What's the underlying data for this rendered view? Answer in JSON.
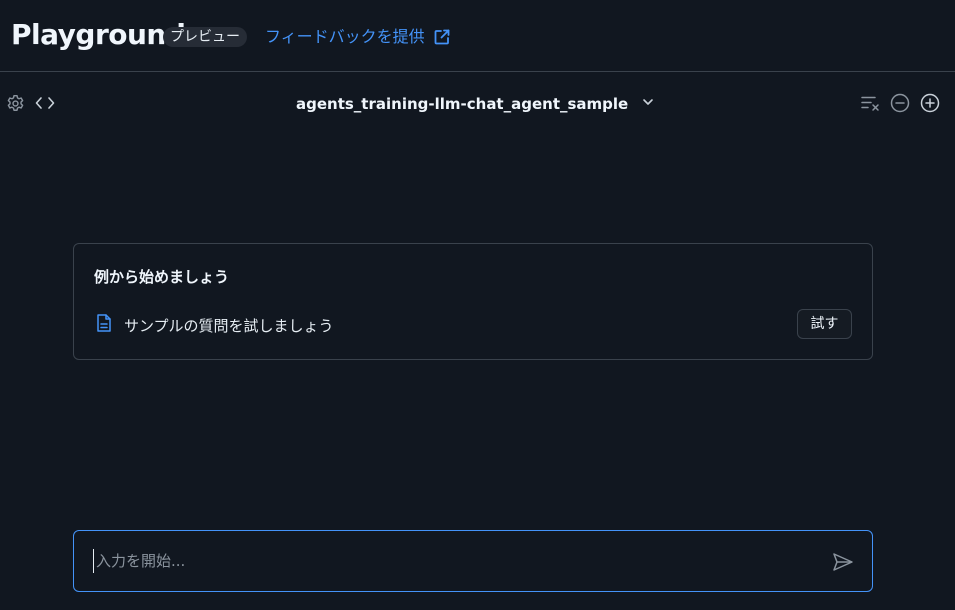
{
  "header": {
    "title": "Playground",
    "badge": "プレビュー",
    "feedback_link": "フィードバックを提供",
    "feedback_icon": "external-link-icon"
  },
  "toolbar": {
    "settings_icon": "gear-icon",
    "code_icon": "code-icon",
    "model_name": "agents_training-llm-chat_agent_sample",
    "model_dropdown_icon": "chevron-down-icon",
    "clear_icon": "clear-list-icon",
    "remove_icon": "minus-circle-icon",
    "add_icon": "plus-circle-icon"
  },
  "example_card": {
    "title": "例から始めましょう",
    "item_icon": "document-icon",
    "item_label": "サンプルの質問を試しましょう",
    "try_button": "試す"
  },
  "chat_input": {
    "placeholder": "入力を開始...",
    "value": "",
    "send_icon": "send-icon"
  },
  "colors": {
    "background": "#111720",
    "accent": "#4493f8",
    "border": "#3a424c",
    "text": "#e6edf3"
  }
}
